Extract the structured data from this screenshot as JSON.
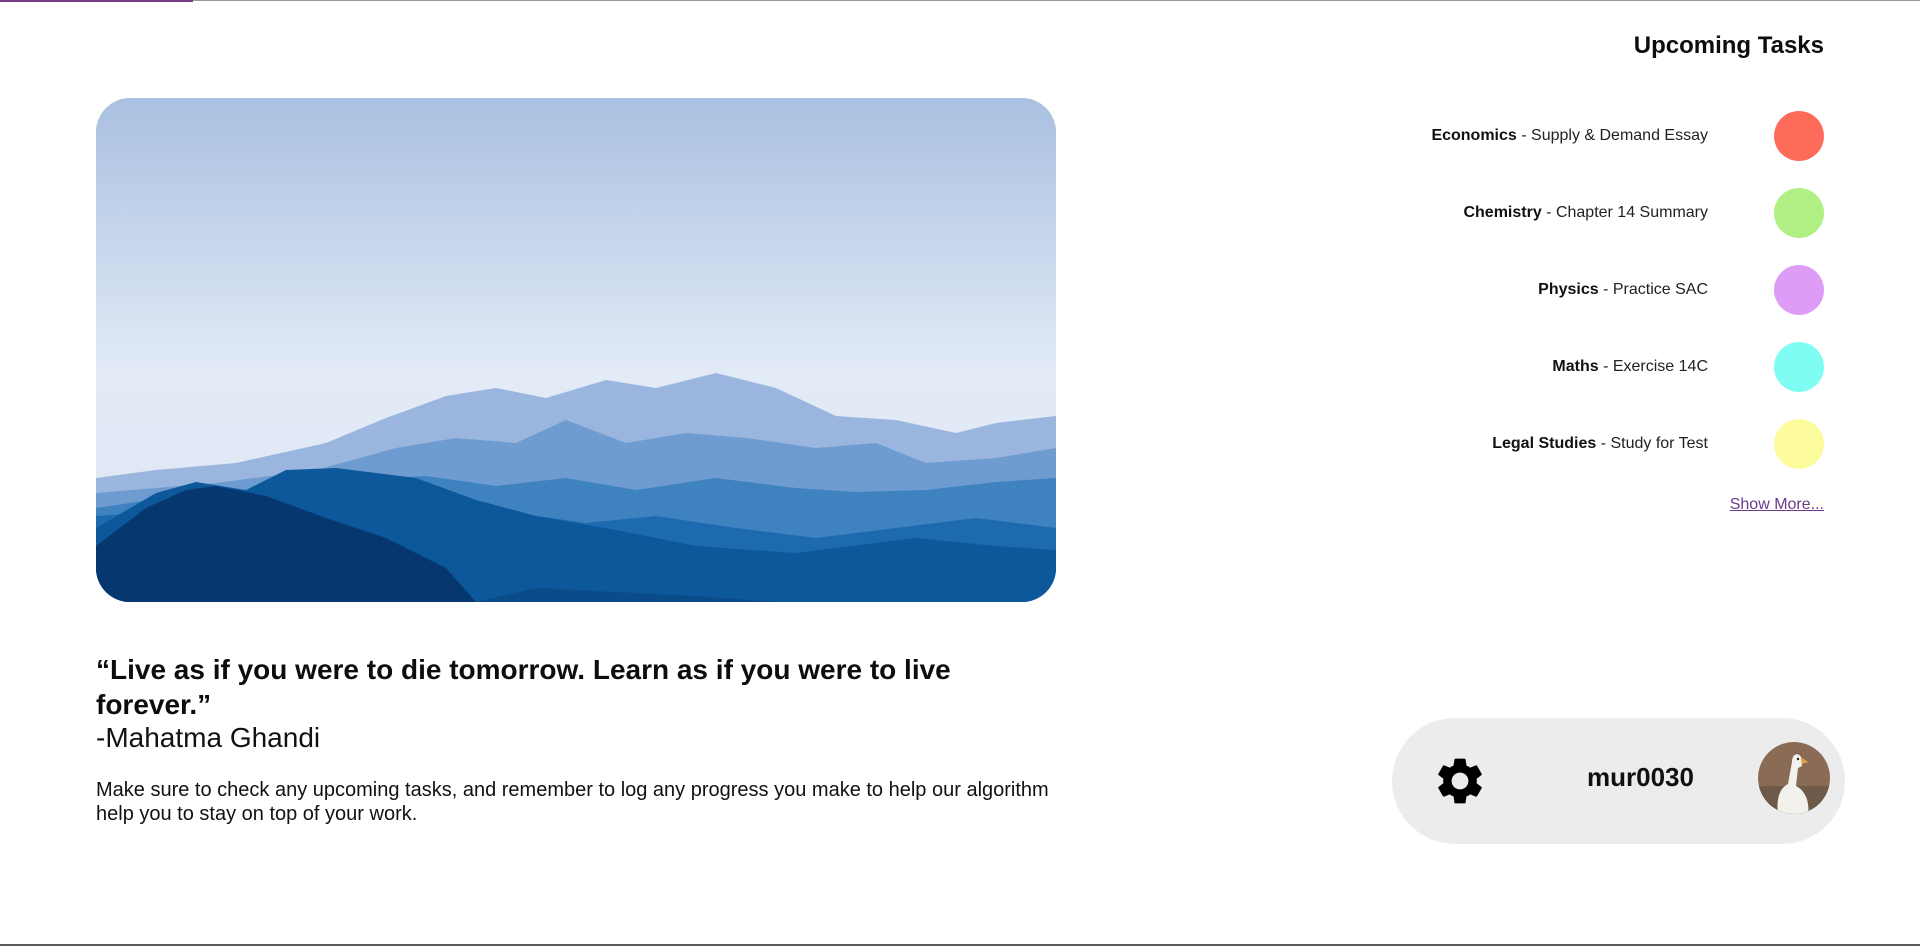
{
  "quote": {
    "text": "“Live as if you were to die tomorrow. Learn as if you were to live forever.”",
    "author": "-Mahatma Ghandi",
    "message": "Make sure to check any upcoming tasks, and remember to log any progress you make to help our algorithm help you to stay on top of your work."
  },
  "tasks": {
    "title": "Upcoming Tasks",
    "items": [
      {
        "subject": "Economics",
        "description": " - Supply & Demand Essay",
        "color": "#ff6b5b"
      },
      {
        "subject": "Chemistry",
        "description": " - Chapter 14 Summary",
        "color": "#b0ef84"
      },
      {
        "subject": "Physics",
        "description": " - Practice SAC",
        "color": "#dd9cf6"
      },
      {
        "subject": "Maths",
        "description": " - Exercise 14C",
        "color": "#7ffdf3"
      },
      {
        "subject": "Legal Studies",
        "description": " - Study for Test",
        "color": "#fdfc9c"
      }
    ],
    "show_more": "Show More..."
  },
  "user": {
    "username": "mur0030",
    "settings_icon": "gear-icon",
    "avatar": "goose-avatar"
  }
}
